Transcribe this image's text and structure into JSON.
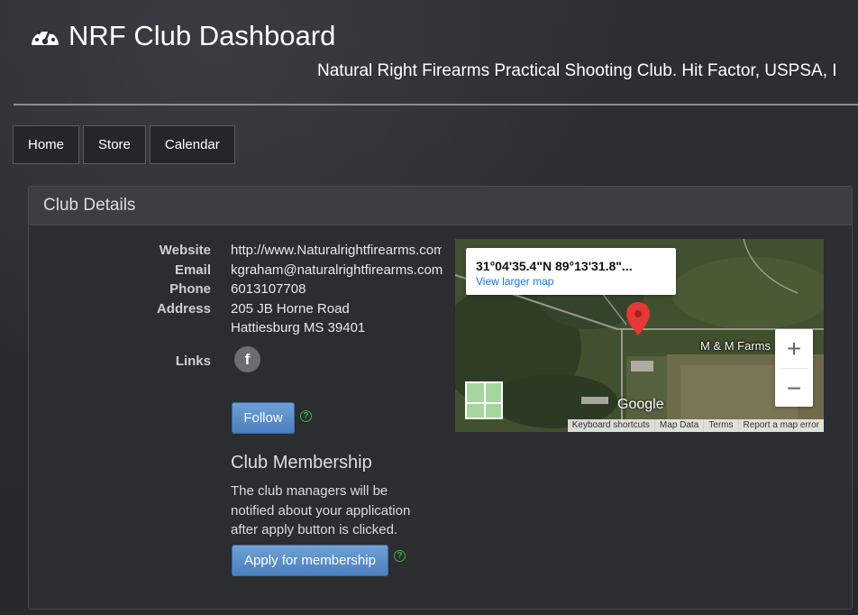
{
  "header": {
    "title": "NRF Club Dashboard",
    "subtitle": "Natural Right Firearms Practical Shooting Club. Hit Factor, USPSA, I",
    "icon": "dashboard-gauge-icon"
  },
  "nav": {
    "items": [
      {
        "label": "Home"
      },
      {
        "label": "Store"
      },
      {
        "label": "Calendar"
      }
    ]
  },
  "panel": {
    "title": "Club Details"
  },
  "details": {
    "website_label": "Website",
    "website_value": "http://www.Naturalrightfirearms.com",
    "email_label": "Email",
    "email_value": "kgraham@naturalrightfirearms.com",
    "phone_label": "Phone",
    "phone_value": "6013107708",
    "address_label": "Address",
    "address_line1": "205 JB Horne Road",
    "address_line2": "Hattiesburg MS 39401",
    "links_label": "Links",
    "facebook_glyph": "f"
  },
  "follow": {
    "label": "Follow",
    "help": "?"
  },
  "membership": {
    "title": "Club Membership",
    "description": "The club managers will be notified about your application after apply button is clicked.",
    "apply_label": "Apply for membership",
    "help": "?"
  },
  "map": {
    "coords": "31°04'35.4\"N 89°13'31.8\"...",
    "view_larger": "View larger map",
    "place_label": "M & M Farms",
    "zoom_in": "+",
    "zoom_out": "−",
    "logo": "Google",
    "footer": {
      "shortcuts": "Keyboard shortcuts",
      "data": "Map Data",
      "terms": "Terms",
      "report": "Report a map error"
    },
    "pin_color": "#e53935"
  },
  "colors": {
    "button_blue": "#5a8dcb",
    "help_green": "#3fb03f",
    "link_blue": "#1a73e8"
  }
}
